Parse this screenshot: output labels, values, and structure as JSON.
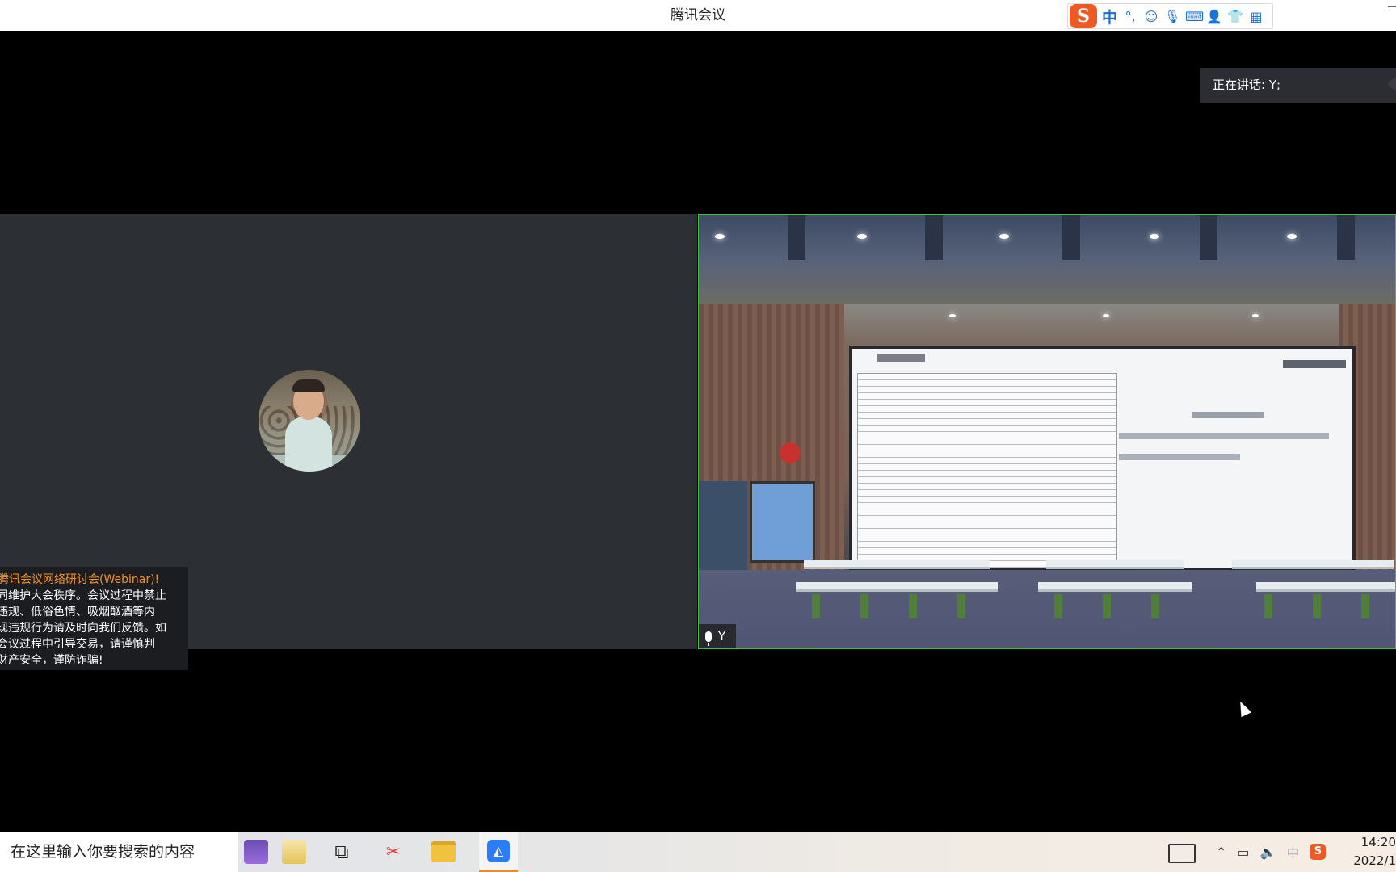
{
  "window": {
    "title": "腾讯会议"
  },
  "ime_toolbar": {
    "logo": "S",
    "mode": "中",
    "punctuation": "°,",
    "icons": [
      "emoji-icon",
      "microphone-icon",
      "keyboard-icon",
      "user-icon",
      "shirt-icon",
      "grid-icon"
    ]
  },
  "speaking": {
    "text": "正在讲话: Y;"
  },
  "notice": {
    "title": "腾讯会议网络研讨会(Webinar)!",
    "lines": [
      "同维护大会秩序。会议过程中禁止",
      "违规、低俗色情、吸烟酗酒等内",
      "现违规行为请及时向我们反馈。如",
      "会议过程中引导交易，请谨慎判",
      "财产安全，谨防诈骗!"
    ]
  },
  "participants": {
    "right_name": "Y"
  },
  "taskbar": {
    "search_placeholder": "在这里输入你要搜索的内容",
    "tray_ime": "中",
    "time": "14:20",
    "date": "2022/1"
  },
  "colors": {
    "accent_border": "#38c23d",
    "notice_title": "#f0922c",
    "meeting_app": "#2a7cf7",
    "ime_brand": "#ef5a24"
  }
}
